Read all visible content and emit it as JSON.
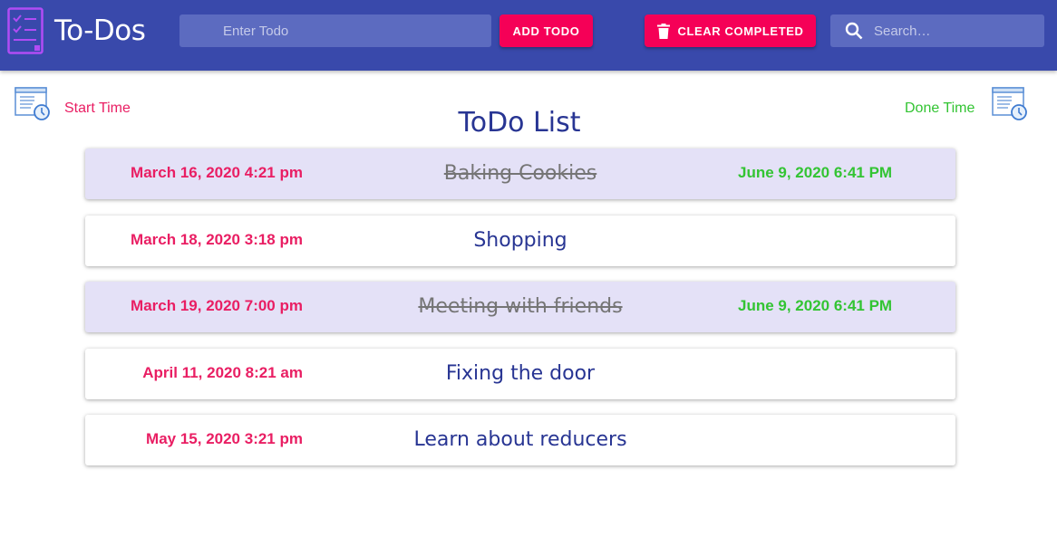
{
  "app": {
    "title": "To-Dos"
  },
  "toolbar": {
    "todo_placeholder": "Enter Todo",
    "todo_value": "",
    "add_label": "ADD TODO",
    "clear_label": "CLEAR COMPLETED",
    "search_placeholder": "Search…",
    "search_value": ""
  },
  "header": {
    "start_label": "Start Time",
    "done_label": "Done Time",
    "list_title": "ToDo List"
  },
  "todos": [
    {
      "text": "Baking Cookies",
      "start": "March 16, 2020 4:21 pm",
      "done": "June 9, 2020 6:41 PM",
      "completed": true
    },
    {
      "text": "Shopping",
      "start": "March 18, 2020 3:18 pm",
      "done": "",
      "completed": false
    },
    {
      "text": "Meeting with friends",
      "start": "March 19, 2020 7:00 pm",
      "done": "June 9, 2020 6:41 PM",
      "completed": true
    },
    {
      "text": "Fixing the door",
      "start": "April 11, 2020 8:21 am",
      "done": "",
      "completed": false
    },
    {
      "text": "Learn about reducers",
      "start": "May 15, 2020 3:21 pm",
      "done": "",
      "completed": false
    }
  ],
  "colors": {
    "appbar": "#3949ab",
    "accent": "#f50057",
    "start_time": "#e91e63",
    "done_time": "#33c433",
    "completed_row": "#e4e1f7",
    "title": "#283593"
  },
  "icons": {
    "logo": "checklist-icon",
    "clear": "trash-icon",
    "search": "search-icon",
    "start": "timer-document-icon",
    "done": "timer-document-icon"
  }
}
